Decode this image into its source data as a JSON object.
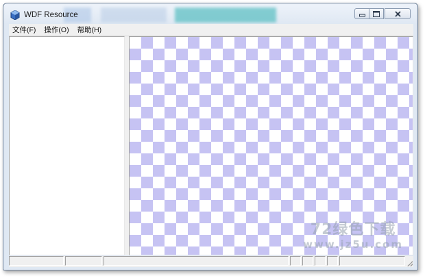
{
  "window": {
    "title": "WDF Resource",
    "icon": "wdf-app-icon",
    "controls": {
      "minimize_icon": "minimize-icon",
      "maximize_icon": "maximize-icon",
      "close_icon": "close-icon"
    }
  },
  "menu": {
    "items": [
      {
        "label": "文件(F)"
      },
      {
        "label": "操作(O)"
      },
      {
        "label": "帮助(H)"
      }
    ]
  },
  "preview": {
    "checker_color": "#c6c3f3",
    "watermark_top": "72绿色下载",
    "watermark_bottom": "www.jz5u.com"
  },
  "statusbar": {
    "cells": [
      "",
      "",
      "",
      "",
      "",
      "",
      "",
      ""
    ]
  }
}
